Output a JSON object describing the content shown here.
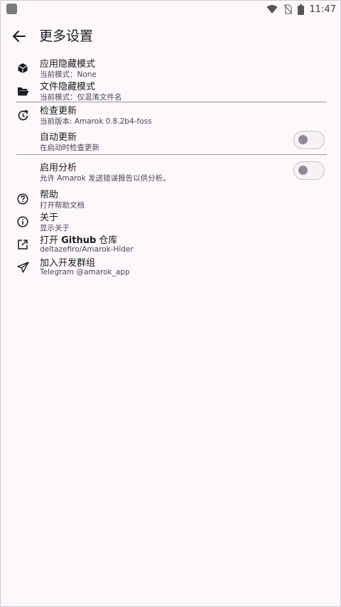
{
  "status": {
    "time": "11:47"
  },
  "app_bar": {
    "title": "更多设置"
  },
  "items": [
    {
      "title": "应用隐藏模式",
      "subtitle": "当前模式：None",
      "icon": "cube-icon"
    },
    {
      "title": "文件隐藏模式",
      "subtitle": "当前模式：仅混淆文件名",
      "icon": "folder-open-icon"
    },
    {
      "title": "检查更新",
      "subtitle": "当前版本: Amarok 0.8.2b4-foss",
      "icon": "update-icon"
    },
    {
      "title": "自动更新",
      "subtitle": "在启动时检查更新",
      "toggle": false
    },
    {
      "title": "启用分析",
      "subtitle": "允许 Amarok 发送错误报告以供分析。",
      "toggle": false
    },
    {
      "title": "帮助",
      "subtitle": "打开帮助文档",
      "icon": "help-circle-icon"
    },
    {
      "title": "关于",
      "subtitle": "显示关于",
      "icon": "info-circle-icon"
    },
    {
      "title_prefix": "打开 ",
      "title_bold": "Github",
      "title_suffix": " 仓库",
      "subtitle": "deltazefiro/Amarok-Hider",
      "icon": "open-external-icon"
    },
    {
      "title": "加入开发群组",
      "subtitle": "Telegram @amarok_app",
      "icon": "telegram-send-icon"
    }
  ]
}
